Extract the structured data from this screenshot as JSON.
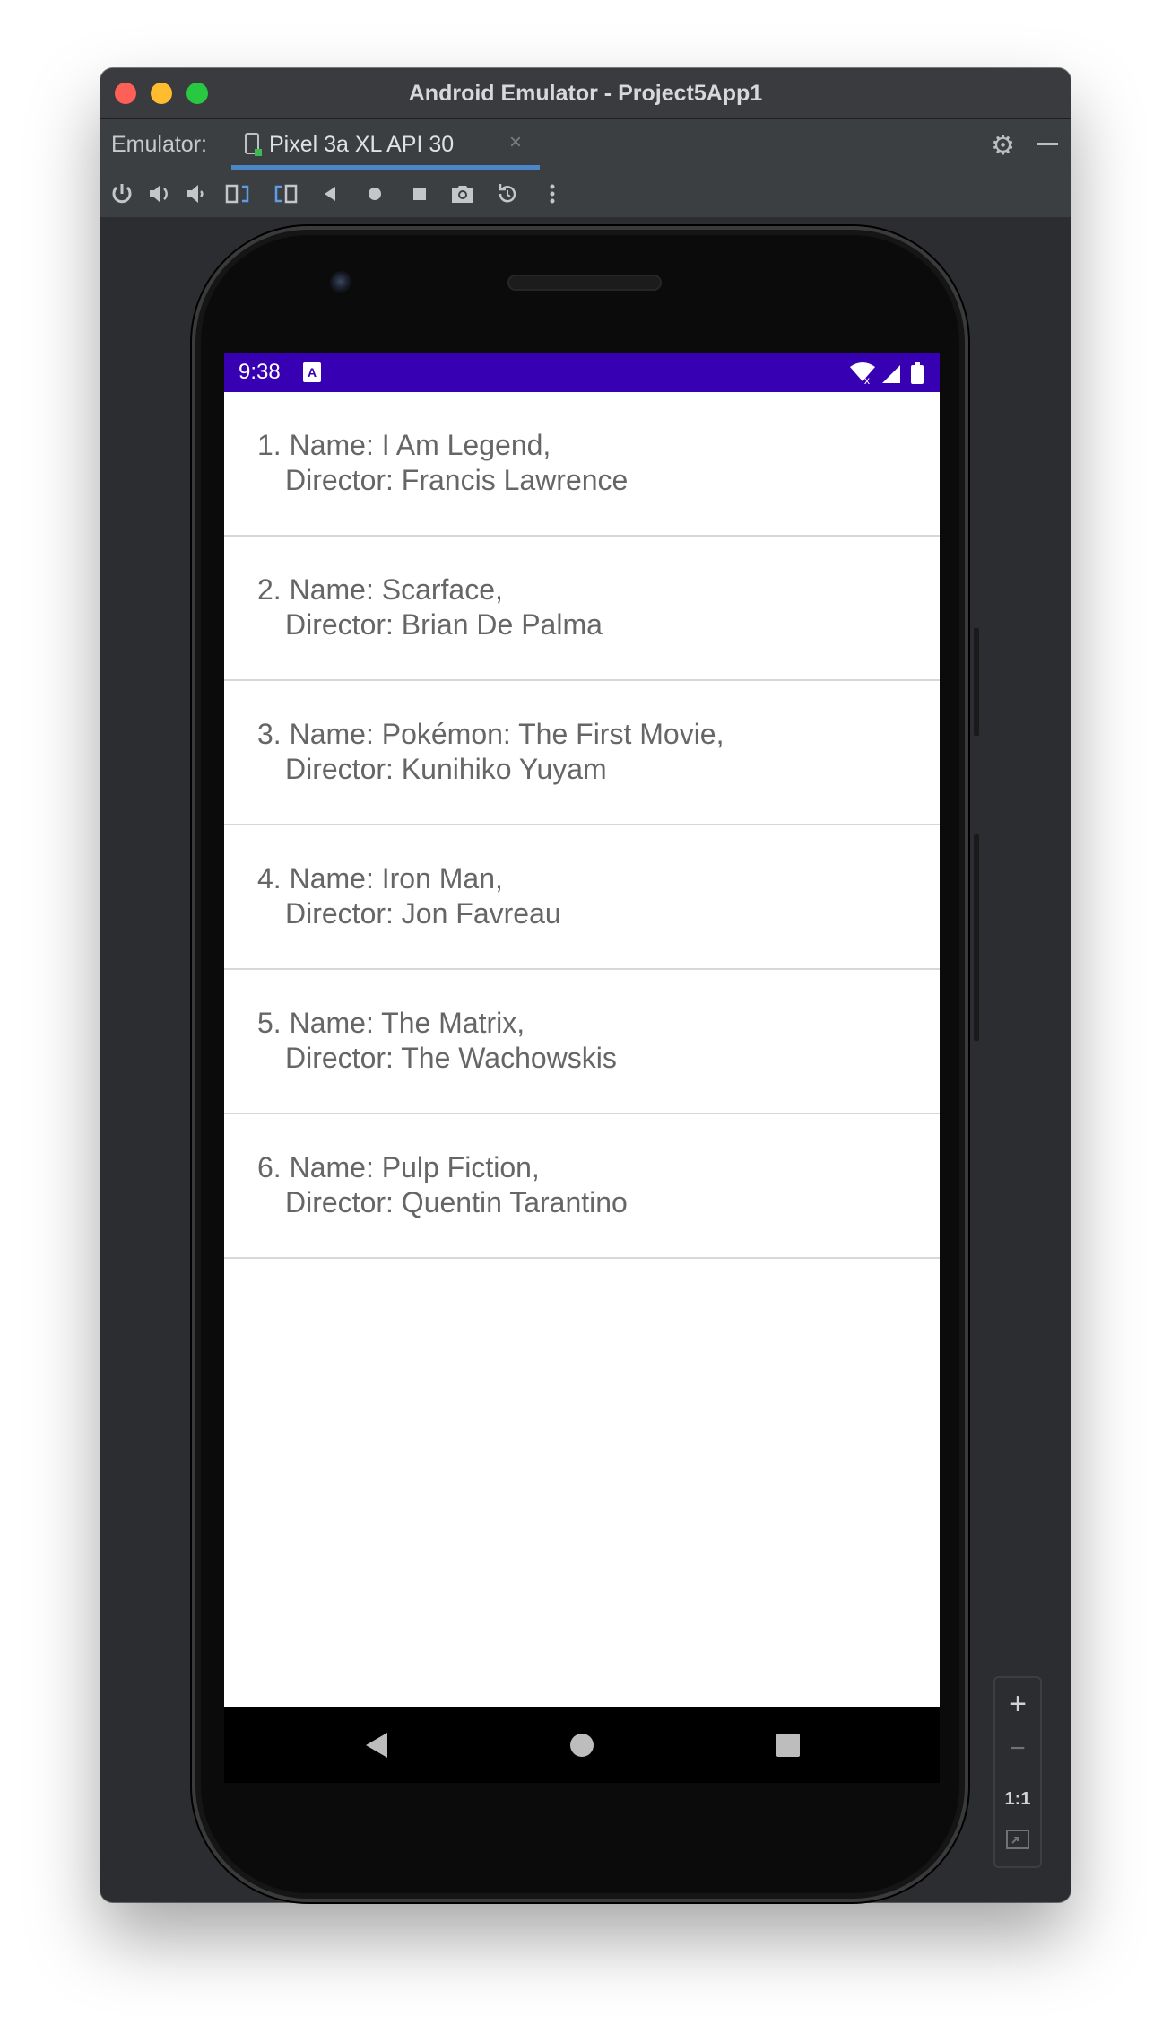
{
  "window": {
    "title": "Android Emulator - Project5App1"
  },
  "tabbar": {
    "label": "Emulator:",
    "device_tab": "Pixel 3a XL API 30",
    "close": "×"
  },
  "toolbar": {
    "icons": [
      "power-icon",
      "volume-up-icon",
      "volume-down-icon",
      "rotate-left-icon",
      "rotate-right-icon",
      "back-icon",
      "home-icon",
      "overview-icon",
      "camera-icon",
      "reset-icon",
      "more-icon"
    ]
  },
  "device": {
    "status": {
      "time": "9:38",
      "notification_glyph": "A",
      "bar_color": "#3700b3"
    },
    "movies": [
      {
        "line1": "1. Name: I Am Legend,",
        "line2": "Director: Francis Lawrence"
      },
      {
        "line1": "2. Name: Scarface,",
        "line2": "Director: Brian De Palma"
      },
      {
        "line1": "3. Name: Pokémon: The First Movie,",
        "line2": "Director: Kunihiko Yuyam"
      },
      {
        "line1": "4. Name: Iron Man,",
        "line2": "Director: Jon Favreau"
      },
      {
        "line1": "5. Name: The Matrix,",
        "line2": "Director: The Wachowskis"
      },
      {
        "line1": "6. Name: Pulp Fiction,",
        "line2": "Director: Quentin Tarantino"
      }
    ]
  },
  "zoom": {
    "plus": "+",
    "minus": "−",
    "one_to_one": "1:1"
  }
}
